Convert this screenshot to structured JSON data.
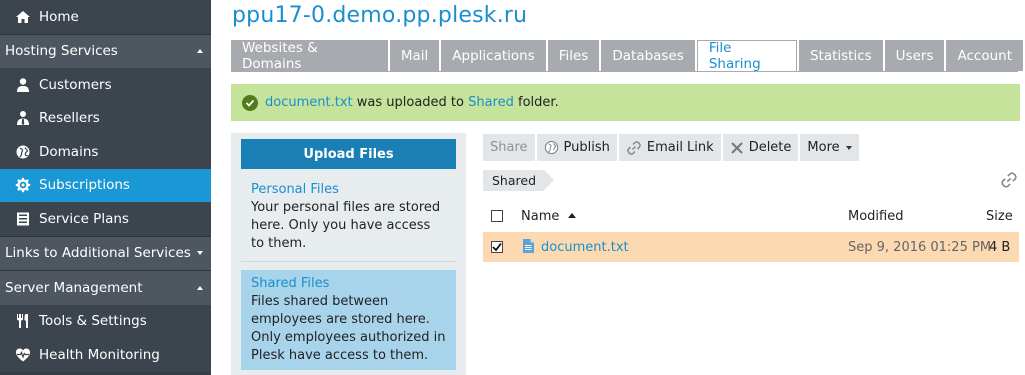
{
  "sidebar": {
    "home": "Home",
    "hosting_services": "Hosting Services",
    "customers": "Customers",
    "resellers": "Resellers",
    "domains": "Domains",
    "subscriptions": "Subscriptions",
    "service_plans": "Service Plans",
    "links_additional": "Links to Additional Services",
    "server_management": "Server Management",
    "tools_settings": "Tools & Settings",
    "health_monitoring": "Health Monitoring"
  },
  "page_title": "ppu17-0.demo.pp.plesk.ru",
  "tabs": [
    {
      "label": "Websites & Domains"
    },
    {
      "label": "Mail"
    },
    {
      "label": "Applications"
    },
    {
      "label": "Files"
    },
    {
      "label": "Databases"
    },
    {
      "label": "File Sharing"
    },
    {
      "label": "Statistics"
    },
    {
      "label": "Users"
    },
    {
      "label": "Account"
    }
  ],
  "notice": {
    "file": "document.txt",
    "middle": " was uploaded to ",
    "folder": "Shared",
    "end": " folder."
  },
  "left_panel": {
    "upload_label": "Upload Files",
    "personal_title": "Personal Files",
    "personal_desc": "Your personal files are stored here. Only you have access to them.",
    "shared_title": "Shared Files",
    "shared_desc": "Files shared between employees are stored here. Only employees authorized in Plesk have access to them."
  },
  "toolbar": {
    "share": "Share",
    "publish": "Publish",
    "email_link": "Email Link",
    "delete": "Delete",
    "more": "More"
  },
  "breadcrumb": "Shared",
  "table": {
    "col_name": "Name",
    "col_modified": "Modified",
    "col_size": "Size",
    "rows": [
      {
        "name": "document.txt",
        "modified": "Sep 9, 2016 01:25 PM",
        "size": "4 B",
        "checked": true
      }
    ]
  },
  "colors": {
    "accent": "#1a8fcf",
    "sidebar_bg": "#353d46",
    "active_item": "#1a97d5",
    "notice_bg": "#c5e39b",
    "selected_row": "#fcd9b0"
  }
}
